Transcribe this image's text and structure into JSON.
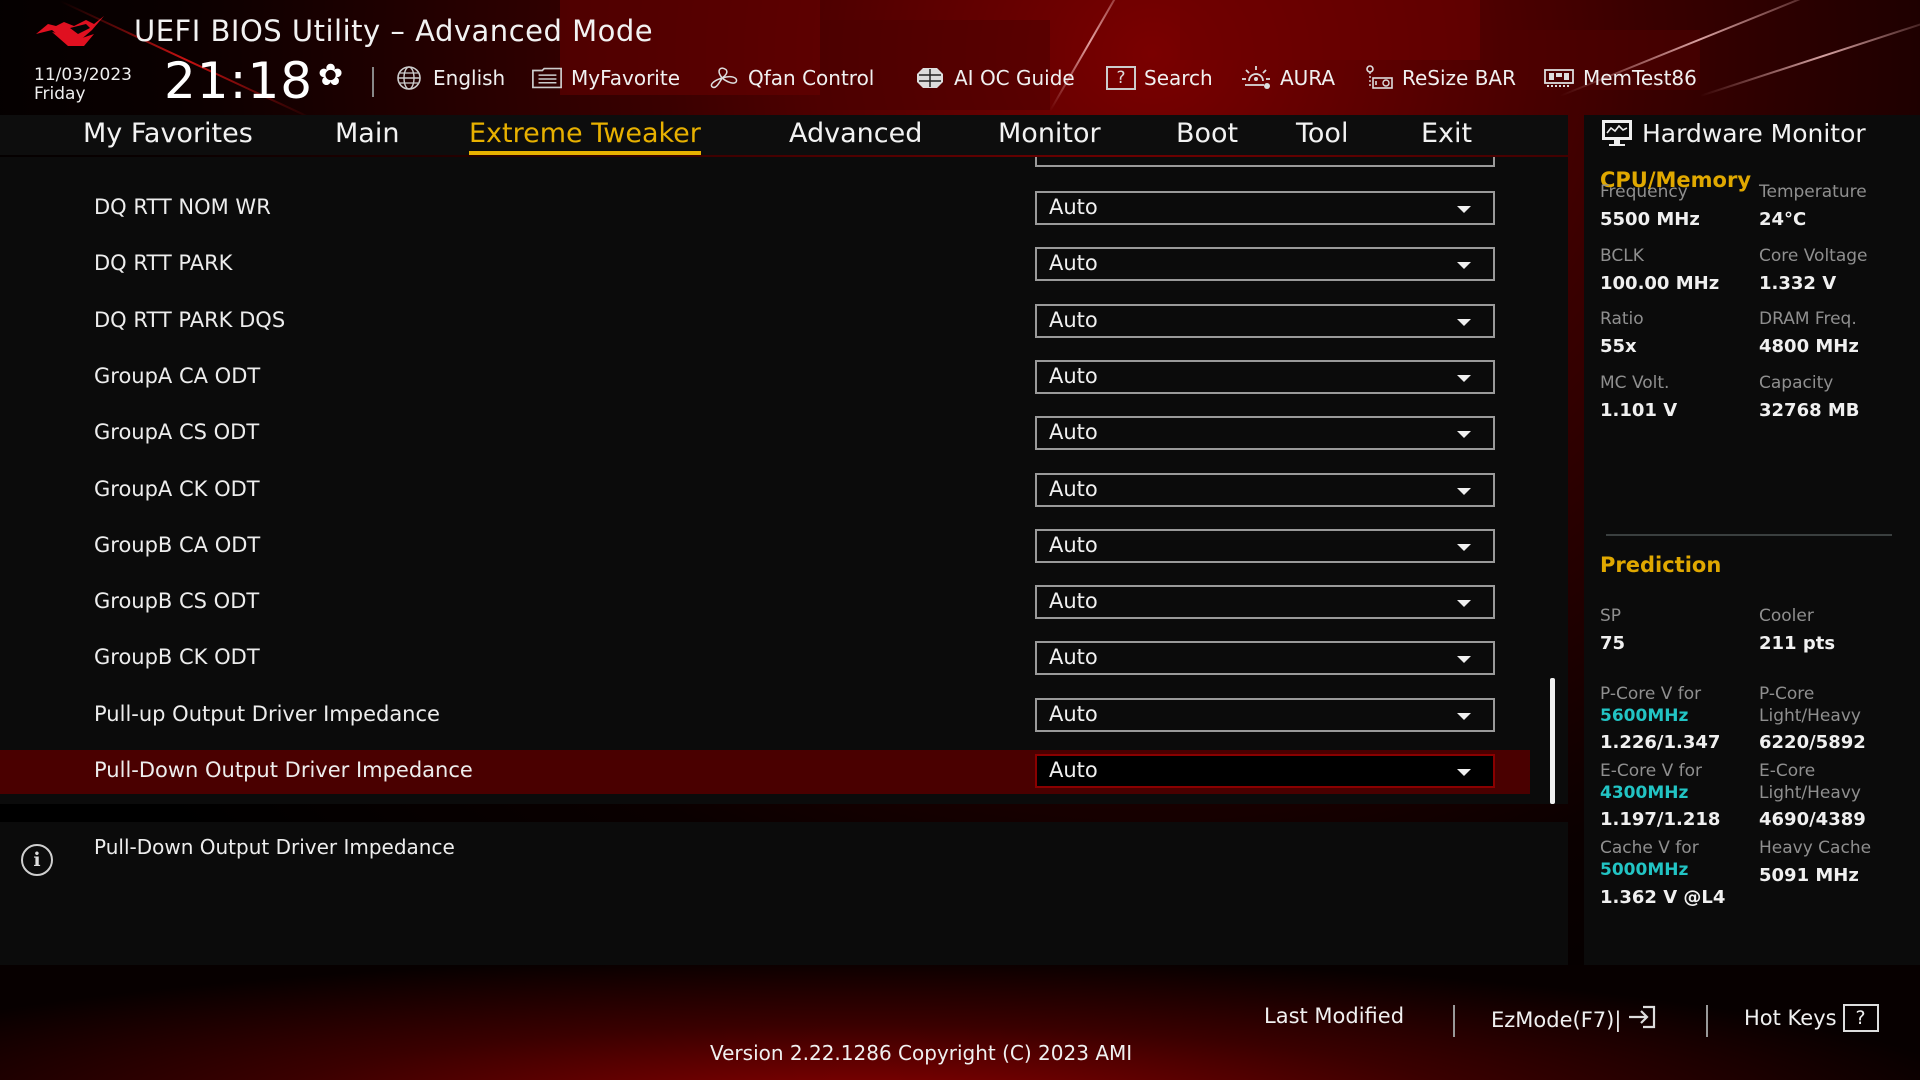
{
  "header": {
    "title": "UEFI BIOS Utility – Advanced Mode",
    "date": "11/03/2023",
    "day": "Friday",
    "time": "21:18",
    "settings_icon": "gear-icon"
  },
  "toolbar": [
    {
      "label": "English",
      "icon": "globe-icon"
    },
    {
      "label": "MyFavorite",
      "icon": "favorite-list-icon"
    },
    {
      "label": "Qfan Control",
      "icon": "fan-icon"
    },
    {
      "label": "AI OC Guide",
      "icon": "ai-oc-guide-icon"
    },
    {
      "label": "Search",
      "icon": "search-question-icon"
    },
    {
      "label": "AURA",
      "icon": "aura-light-icon"
    },
    {
      "label": "ReSize BAR",
      "icon": "resize-bar-icon"
    },
    {
      "label": "MemTest86",
      "icon": "memory-icon"
    }
  ],
  "nav": {
    "tabs": [
      "My Favorites",
      "Main",
      "Extreme Tweaker",
      "Advanced",
      "Monitor",
      "Boot",
      "Tool",
      "Exit"
    ],
    "active": "Extreme Tweaker"
  },
  "settings": {
    "rows": [
      {
        "label": "DQ RTT NOM WR",
        "value": "Auto"
      },
      {
        "label": "DQ RTT PARK",
        "value": "Auto"
      },
      {
        "label": "DQ RTT PARK DQS",
        "value": "Auto"
      },
      {
        "label": "GroupA CA ODT",
        "value": "Auto"
      },
      {
        "label": "GroupA CS ODT",
        "value": "Auto"
      },
      {
        "label": "GroupA CK ODT",
        "value": "Auto"
      },
      {
        "label": "GroupB CA ODT",
        "value": "Auto"
      },
      {
        "label": "GroupB CS ODT",
        "value": "Auto"
      },
      {
        "label": "GroupB CK ODT",
        "value": "Auto"
      },
      {
        "label": "Pull-up Output Driver Impedance",
        "value": "Auto"
      },
      {
        "label": "Pull-Down Output Driver Impedance",
        "value": "Auto"
      }
    ],
    "selected_index": 10
  },
  "info": {
    "text": "Pull-Down Output Driver Impedance"
  },
  "hardware_monitor": {
    "title": "Hardware Monitor",
    "cpu_memory": {
      "heading": "CPU/Memory",
      "items": [
        {
          "label": "Frequency",
          "value": "5500 MHz"
        },
        {
          "label": "Temperature",
          "value": "24°C"
        },
        {
          "label": "BCLK",
          "value": "100.00 MHz"
        },
        {
          "label": "Core Voltage",
          "value": "1.332 V"
        },
        {
          "label": "Ratio",
          "value": "55x"
        },
        {
          "label": "DRAM Freq.",
          "value": "4800 MHz"
        },
        {
          "label": "MC Volt.",
          "value": "1.101 V"
        },
        {
          "label": "Capacity",
          "value": "32768 MB"
        }
      ]
    },
    "prediction": {
      "heading": "Prediction",
      "sp_label": "SP",
      "sp_value": "75",
      "cooler_label": "Cooler",
      "cooler_value": "211 pts",
      "pcore_v_label": "P-Core V for",
      "pcore_v_freq": "5600MHz",
      "pcore_v_value": "1.226/1.347",
      "pcore_lh_label1": "P-Core",
      "pcore_lh_label2": "Light/Heavy",
      "pcore_lh_value": "6220/5892",
      "ecore_v_label": "E-Core V for",
      "ecore_v_freq": "4300MHz",
      "ecore_v_value": "1.197/1.218",
      "ecore_lh_label1": "E-Core",
      "ecore_lh_label2": "Light/Heavy",
      "ecore_lh_value": "4690/4389",
      "cache_v_label": "Cache V for",
      "cache_v_freq": "5000MHz",
      "cache_v_value": "1.362 V @L4",
      "heavy_cache_label": "Heavy Cache",
      "heavy_cache_value": "5091 MHz"
    }
  },
  "footer": {
    "last_modified": "Last Modified",
    "ezmode": "EzMode(F7)|",
    "hotkeys": "Hot Keys",
    "hotkeys_icon_glyph": "?",
    "version": "Version 2.22.1286 Copyright (C) 2023 AMI"
  },
  "colors": {
    "accent_gold": "#e8b100",
    "selected_row": "#4a0000",
    "prediction_freq": "#22c4c4",
    "brand_red": "#e01020"
  }
}
